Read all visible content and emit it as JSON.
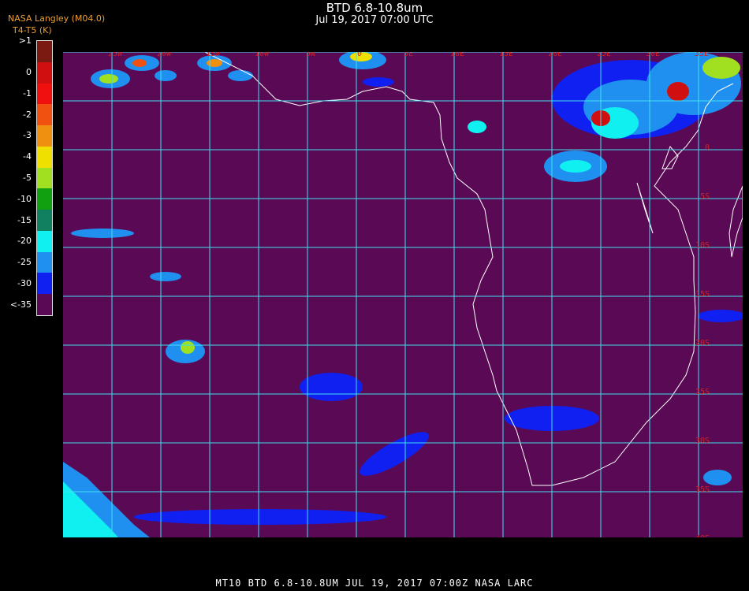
{
  "header": {
    "title": "BTD 6.8-10.8um",
    "subtitle": "Jul 19, 2017 07:00 UTC",
    "credit": "NASA Langley (M04.0)",
    "units": "T4-T5 (K)"
  },
  "legend": {
    "labels": [
      ">1",
      "0",
      "-1",
      "-2",
      "-3",
      "-4",
      "-5",
      "-10",
      "-15",
      "-20",
      "-25",
      "-30",
      "<-35"
    ],
    "colors": [
      "#7a1a10",
      "#d01010",
      "#f01010",
      "#f05010",
      "#f09010",
      "#f0e000",
      "#a0e020",
      "#10a010",
      "#108060",
      "#10f0f0",
      "#2090f0",
      "#1020f0",
      "#5a0a55"
    ]
  },
  "map": {
    "background": "#5a0a55",
    "grid_color": "#40e0f0",
    "lon_labels": [
      "25W",
      "20W",
      "15W",
      "10W",
      "5W",
      "0",
      "5E",
      "10E",
      "15E",
      "20E",
      "25E",
      "30E",
      "35E"
    ],
    "lat_labels": [
      "0",
      "5S",
      "10S",
      "15S",
      "20S",
      "25S",
      "30S",
      "35S",
      "40S"
    ],
    "label_color": "#d02020"
  },
  "footer": {
    "text": "MT10  BTD 6.8-10.8UM   JUL 19, 2017 07:00Z   NASA LARC"
  }
}
